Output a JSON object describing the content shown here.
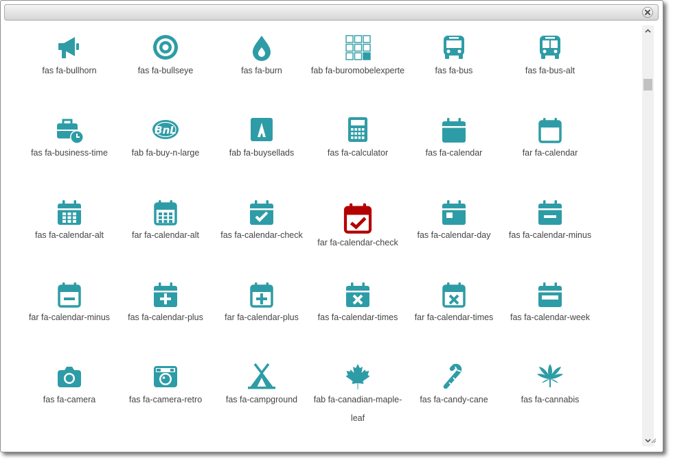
{
  "icon_color": "#2e9ca6",
  "selected_color": "#b30000",
  "rows": [
    [
      {
        "label": "fas fa-bullhorn",
        "icon": "bullhorn-icon"
      },
      {
        "label": "fas fa-bullseye",
        "icon": "bullseye-icon"
      },
      {
        "label": "fas fa-burn",
        "icon": "burn-icon"
      },
      {
        "label": "fab fa-buromobelexperte",
        "icon": "buromobelexperte-icon"
      },
      {
        "label": "fas fa-bus",
        "icon": "bus-icon"
      },
      {
        "label": "fas fa-bus-alt",
        "icon": "bus-alt-icon"
      }
    ],
    [
      {
        "label": "fas fa-business-time",
        "icon": "business-time-icon"
      },
      {
        "label": "fab fa-buy-n-large",
        "icon": "buy-n-large-icon"
      },
      {
        "label": "fab fa-buysellads",
        "icon": "buysellads-icon"
      },
      {
        "label": "fas fa-calculator",
        "icon": "calculator-icon"
      },
      {
        "label": "fas fa-calendar",
        "icon": "calendar-icon"
      },
      {
        "label": "far fa-calendar",
        "icon": "calendar-outline-icon"
      }
    ],
    [
      {
        "label": "fas fa-calendar-alt",
        "icon": "calendar-alt-icon"
      },
      {
        "label": "far fa-calendar-alt",
        "icon": "calendar-alt-outline-icon"
      },
      {
        "label": "fas fa-calendar-check",
        "icon": "calendar-check-icon"
      },
      {
        "label": "far fa-calendar-check",
        "icon": "calendar-check-outline-icon",
        "selected": true
      },
      {
        "label": "fas fa-calendar-day",
        "icon": "calendar-day-icon"
      },
      {
        "label": "fas fa-calendar-minus",
        "icon": "calendar-minus-icon"
      }
    ],
    [
      {
        "label": "far fa-calendar-minus",
        "icon": "calendar-minus-outline-icon"
      },
      {
        "label": "fas fa-calendar-plus",
        "icon": "calendar-plus-icon"
      },
      {
        "label": "far fa-calendar-plus",
        "icon": "calendar-plus-outline-icon"
      },
      {
        "label": "fas fa-calendar-times",
        "icon": "calendar-times-icon"
      },
      {
        "label": "far fa-calendar-times",
        "icon": "calendar-times-outline-icon"
      },
      {
        "label": "fas fa-calendar-week",
        "icon": "calendar-week-icon"
      }
    ],
    [
      {
        "label": "fas fa-camera",
        "icon": "camera-icon"
      },
      {
        "label": "fas fa-camera-retro",
        "icon": "camera-retro-icon"
      },
      {
        "label": "fas fa-campground",
        "icon": "campground-icon"
      },
      {
        "label": "fab fa-canadian-maple-leaf",
        "icon": "canadian-maple-leaf-icon"
      },
      {
        "label": "fas fa-candy-cane",
        "icon": "candy-cane-icon"
      },
      {
        "label": "fas fa-cannabis",
        "icon": "cannabis-icon"
      }
    ]
  ]
}
